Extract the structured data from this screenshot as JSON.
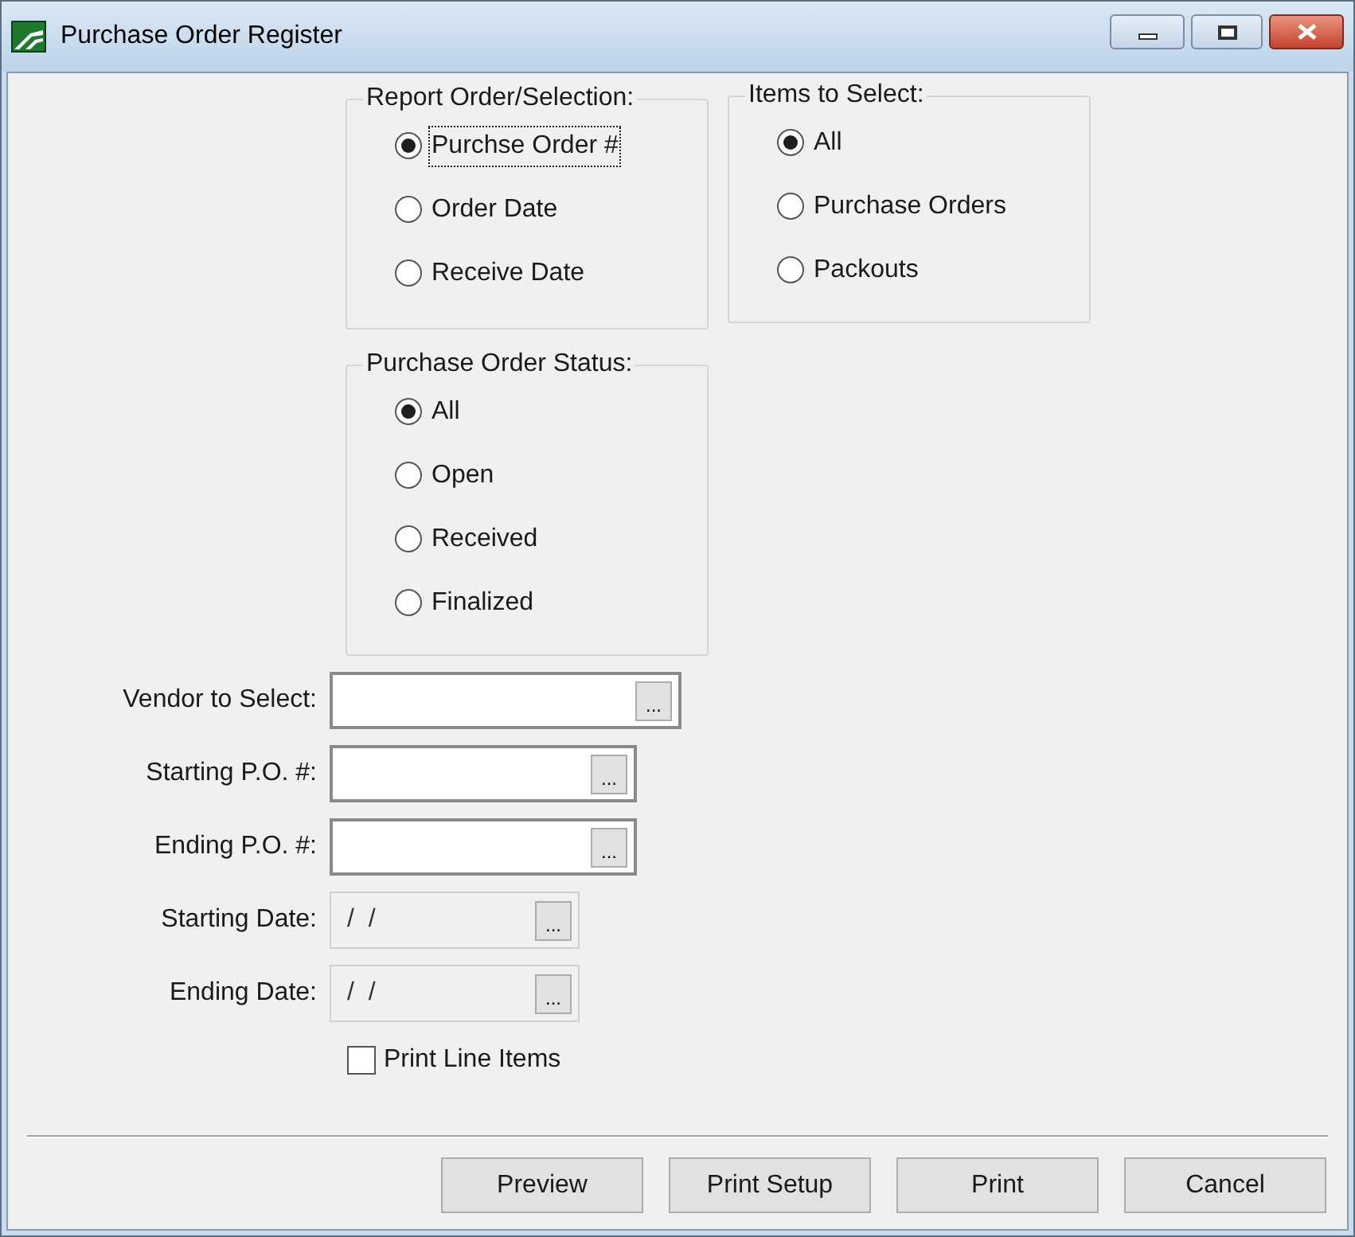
{
  "window": {
    "title": "Purchase Order Register"
  },
  "report_order": {
    "title": "Report Order/Selection:",
    "options": [
      {
        "label": "Purchse Order #",
        "selected": true,
        "focused": true
      },
      {
        "label": "Order Date",
        "selected": false,
        "focused": false
      },
      {
        "label": "Receive Date",
        "selected": false,
        "focused": false
      }
    ]
  },
  "items_to_select": {
    "title": "Items to Select:",
    "options": [
      {
        "label": "All",
        "selected": true,
        "focused": false
      },
      {
        "label": "Purchase Orders",
        "selected": false,
        "focused": false
      },
      {
        "label": "Packouts",
        "selected": false,
        "focused": false
      }
    ]
  },
  "status": {
    "title": "Purchase Order Status:",
    "options": [
      {
        "label": "All",
        "selected": true,
        "focused": false
      },
      {
        "label": "Open",
        "selected": false,
        "focused": false
      },
      {
        "label": "Received",
        "selected": false,
        "focused": false
      },
      {
        "label": "Finalized",
        "selected": false,
        "focused": false
      }
    ]
  },
  "fields": [
    {
      "label": "Vendor to Select:",
      "disabled": false,
      "browse": "..."
    },
    {
      "label": "Starting P.O. #:",
      "disabled": false,
      "browse": "..."
    },
    {
      "label": "Ending P.O. #:",
      "disabled": false,
      "browse": "..."
    },
    {
      "label": "Starting Date:",
      "disabled": true,
      "value": "/  /",
      "browse": "..."
    },
    {
      "label": "Ending Date:",
      "disabled": true,
      "value": "/  /",
      "browse": "..."
    }
  ],
  "print_line_items": {
    "label": "Print Line Items",
    "checked": false
  },
  "buttons": [
    "Preview",
    "Print Setup",
    "Print",
    "Cancel"
  ]
}
